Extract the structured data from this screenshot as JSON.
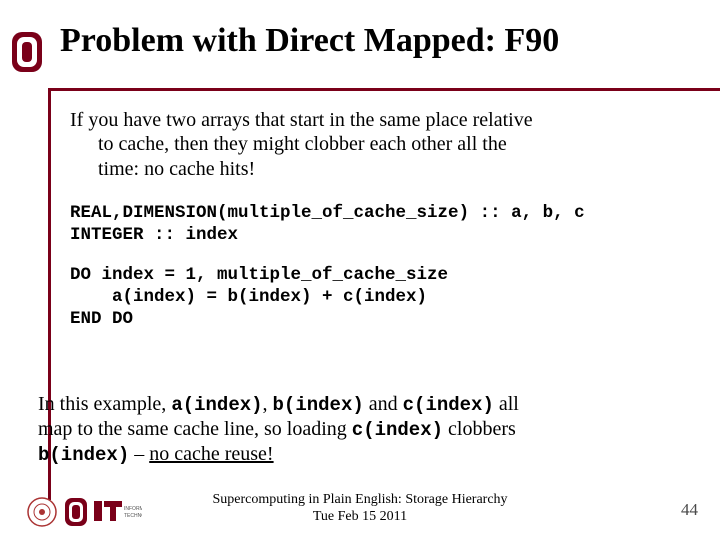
{
  "title": "Problem with Direct Mapped: F90",
  "intro": {
    "line1": "If you have two arrays that start in the same place relative",
    "line2": "to cache, then they might clobber each other all the",
    "line3": "time: no cache hits!"
  },
  "code": {
    "l1": "REAL,DIMENSION(multiple_of_cache_size) :: a, b, c",
    "l2": "INTEGER :: index",
    "l3": "DO index = 1, multiple_of_cache_size",
    "l4": "    a(index) = b(index) + c(index)",
    "l5": "END DO"
  },
  "closing": {
    "p1a": "In this example, ",
    "c1": "a(index)",
    "p1b": ", ",
    "c2": "b(index)",
    "p1c": " and ",
    "c3": "c(index)",
    "p1d": " all",
    "p2a": "map to the same cache line, so loading ",
    "c4": "c(index)",
    "p2b": " clobbers",
    "c5": "b(index)",
    "p3a": " – ",
    "u": "no cache reuse!"
  },
  "footer": {
    "line1": "Supercomputing in Plain English: Storage Hierarchy",
    "line2": "Tue Feb 15 2011",
    "page": "44"
  }
}
